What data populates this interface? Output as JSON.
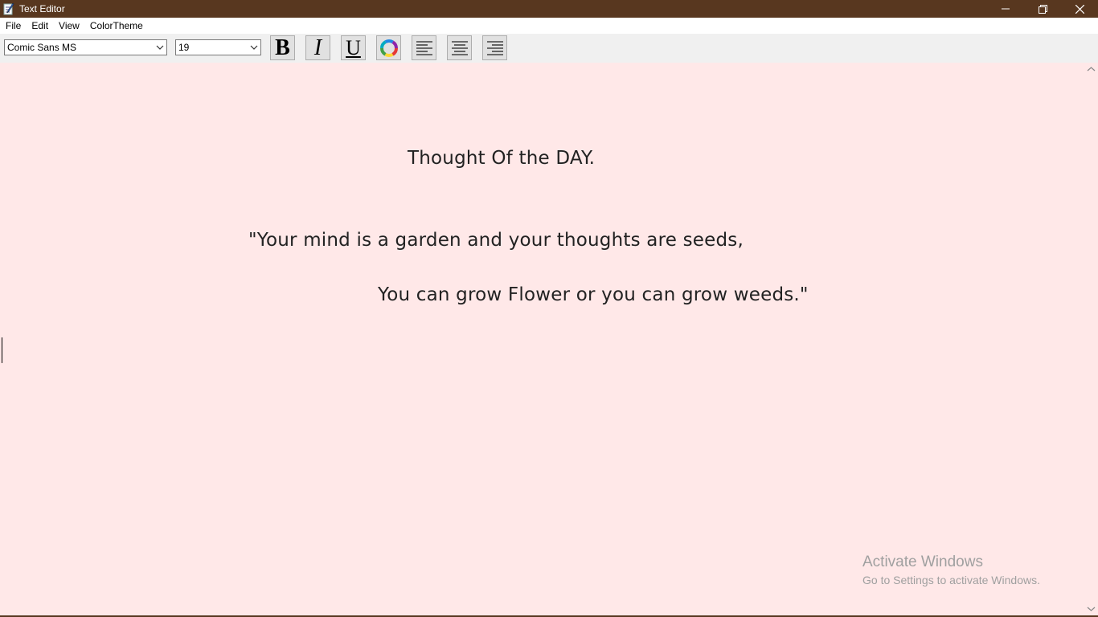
{
  "window": {
    "title": "Text Editor",
    "controls": {
      "minimize_icon": "minimize-icon",
      "restore_icon": "restore-icon",
      "close_icon": "close-icon"
    },
    "titlebar_color": "#58371f"
  },
  "menu": {
    "items": [
      {
        "label": "File"
      },
      {
        "label": "Edit"
      },
      {
        "label": "View"
      },
      {
        "label": "ColorTheme"
      }
    ]
  },
  "toolbar": {
    "font_family": {
      "value": "Comic Sans MS"
    },
    "font_size": {
      "value": "19"
    },
    "buttons": [
      {
        "name": "bold-button",
        "glyph": "B",
        "icon": "bold-icon"
      },
      {
        "name": "italic-button",
        "glyph": "I",
        "icon": "italic-icon"
      },
      {
        "name": "underline-button",
        "glyph": "U",
        "icon": "underline-icon"
      },
      {
        "name": "color-button",
        "icon": "color-wheel-icon"
      },
      {
        "name": "align-left-button",
        "icon": "align-left-icon"
      },
      {
        "name": "align-center-button",
        "icon": "align-center-icon"
      },
      {
        "name": "align-right-button",
        "icon": "align-right-icon"
      }
    ]
  },
  "editor": {
    "background": "#ffe8e8",
    "lines": [
      "Thought Of the DAY.",
      "\"Your mind is a garden and your thoughts are seeds,",
      "You can grow Flower or you can grow weeds.\""
    ]
  },
  "watermark": {
    "title": "Activate Windows",
    "subtitle": "Go to Settings to activate Windows."
  }
}
